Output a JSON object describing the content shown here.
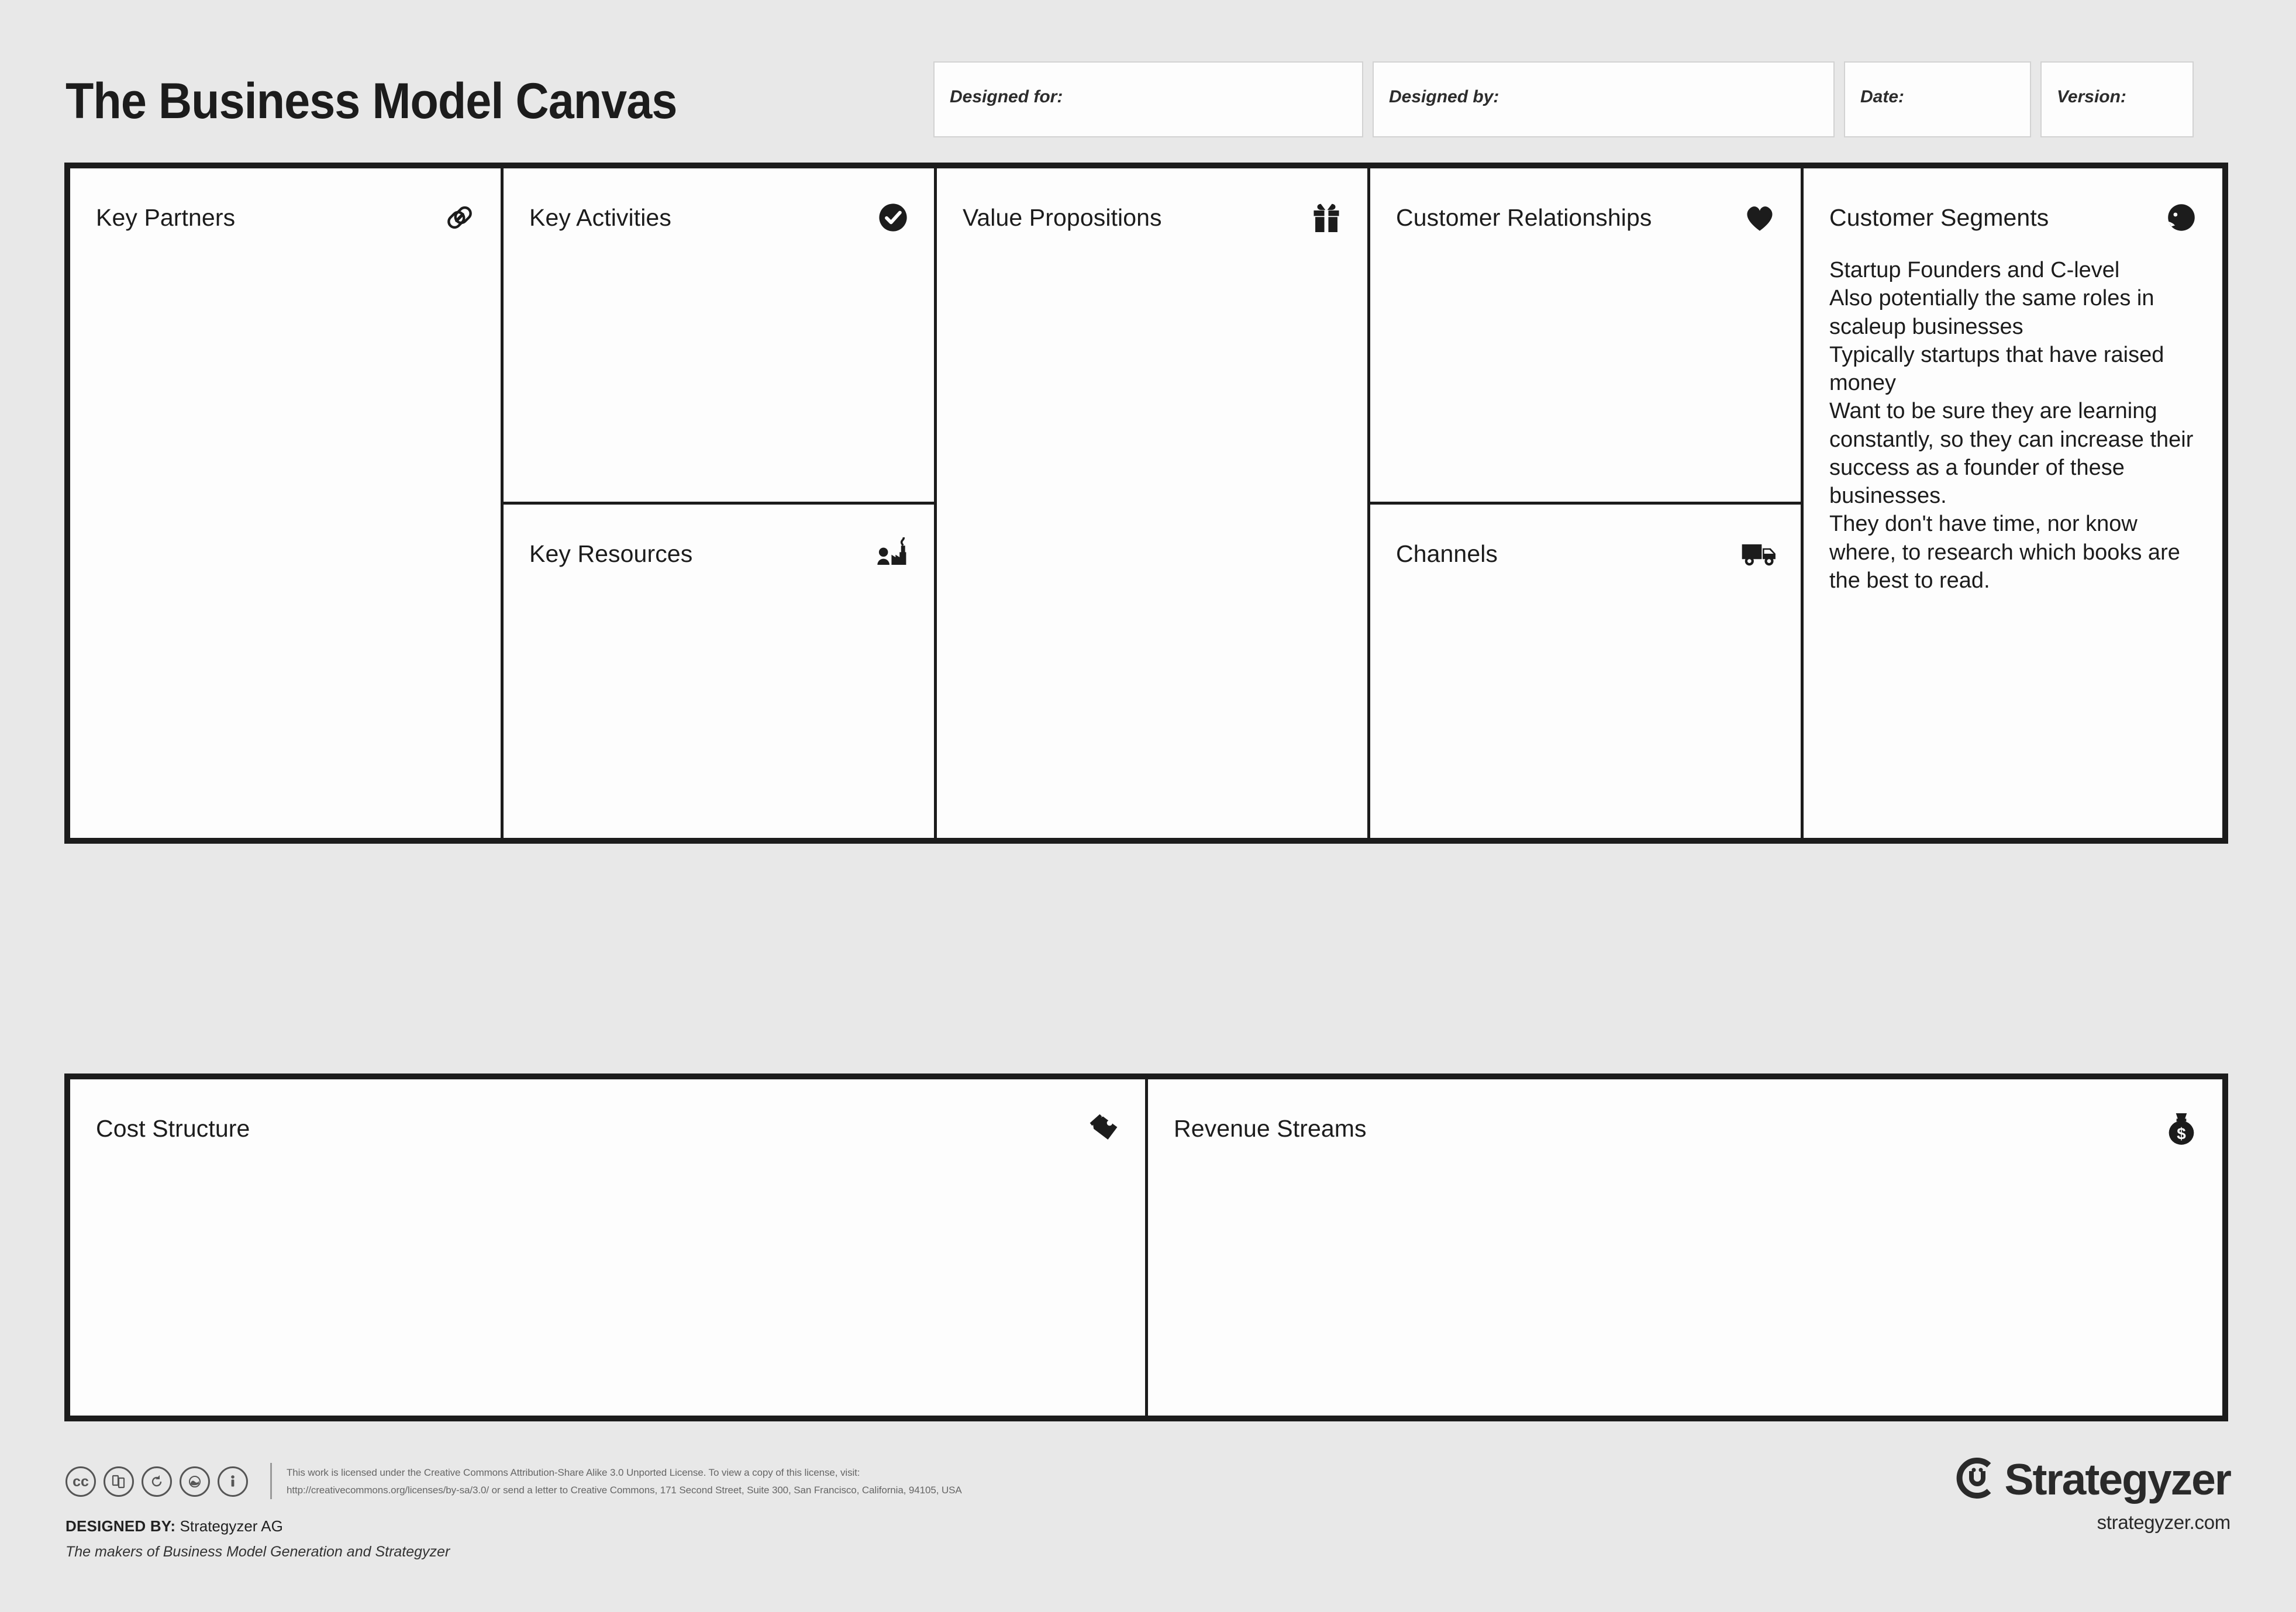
{
  "header": {
    "title": "The Business Model Canvas",
    "fields": [
      {
        "label": "Designed for:",
        "value": ""
      },
      {
        "label": "Designed by:",
        "value": ""
      },
      {
        "label": "Date:",
        "value": ""
      },
      {
        "label": "Version:",
        "value": ""
      }
    ]
  },
  "canvas": {
    "blocks": {
      "key_partners": {
        "title": "Key Partners",
        "icon": "chain-link-icon",
        "content": ""
      },
      "key_activities": {
        "title": "Key Activities",
        "icon": "check-circle-icon",
        "content": ""
      },
      "key_resources": {
        "title": "Key Resources",
        "icon": "factory-worker-icon",
        "content": ""
      },
      "value_propositions": {
        "title": "Value Propositions",
        "icon": "gift-icon",
        "content": ""
      },
      "customer_relationships": {
        "title": "Customer Relationships",
        "icon": "heart-icon",
        "content": ""
      },
      "channels": {
        "title": "Channels",
        "icon": "delivery-truck-icon",
        "content": ""
      },
      "customer_segments": {
        "title": "Customer Segments",
        "icon": "person-head-icon",
        "content": "Startup Founders and C-level\nAlso potentially the same roles in scaleup businesses\nTypically startups that have raised money\nWant to be sure they are learning constantly, so they can increase their success as a founder of these businesses.\nThey don't have time, nor know where, to research which books are the best to read."
      },
      "cost_structure": {
        "title": "Cost Structure",
        "icon": "price-tag-icon",
        "content": ""
      },
      "revenue_streams": {
        "title": "Revenue Streams",
        "icon": "money-bag-icon",
        "content": ""
      }
    }
  },
  "footer": {
    "cc_badges": [
      "cc",
      "by",
      "sa",
      "remix",
      "person"
    ],
    "license_line_1": "This work is licensed under the Creative Commons Attribution-Share Alike 3.0 Unported License. To view a copy of this license, visit:",
    "license_line_2": "http://creativecommons.org/licenses/by-sa/3.0/ or send a letter to Creative Commons, 171 Second Street, Suite 300, San Francisco, California, 94105, USA",
    "designed_by_prefix": "DESIGNED BY:",
    "designed_by_value": "Strategyzer AG",
    "makers": "The makers of Business Model Generation and Strategyzer",
    "brand_name": "Strategyzer",
    "brand_url": "strategyzer.com"
  },
  "colors": {
    "page_background": "#e8e8e8",
    "cell_background": "#fdfdfd",
    "border": "#1c1c1c",
    "text": "#1c1c1c",
    "muted_text": "#666666"
  }
}
